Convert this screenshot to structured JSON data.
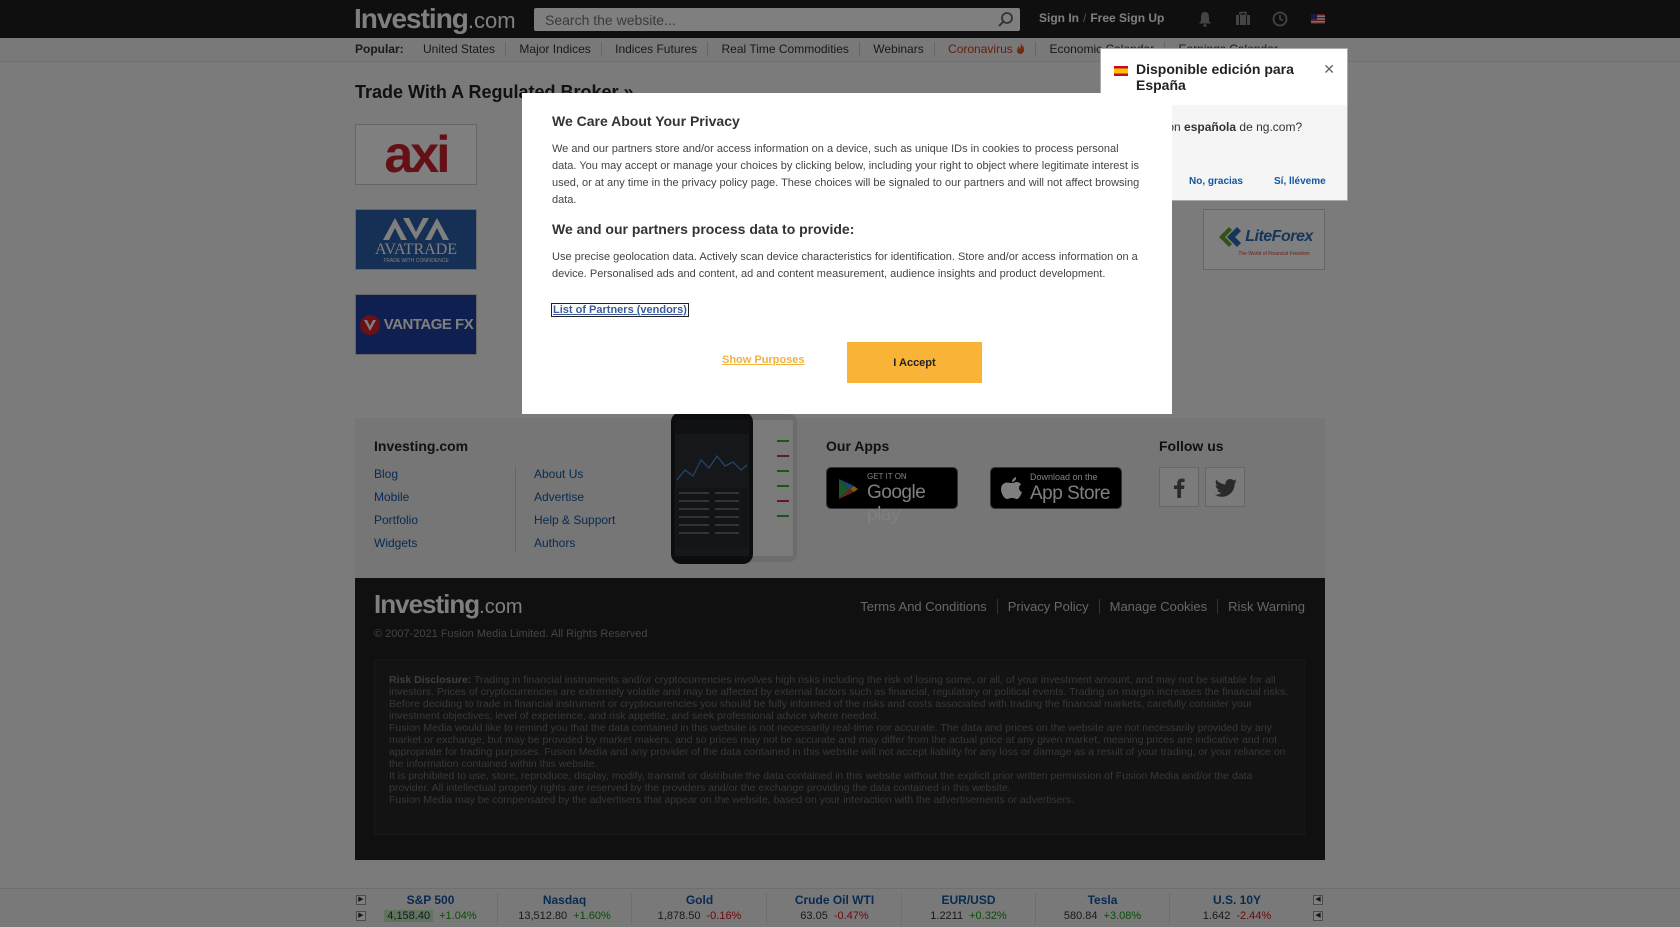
{
  "header": {
    "logo_main": "Investing",
    "logo_suffix": ".com",
    "search_placeholder": "Search the website...",
    "sign_in": "Sign In",
    "sign_sep": "/",
    "free_sign_up": "Free Sign Up"
  },
  "popular": {
    "label": "Popular:",
    "items": [
      "United States",
      "Major Indices",
      "Indices Futures",
      "Real Time Commodities",
      "Webinars",
      "Coronavirus",
      "Economic Calendar",
      "Earnings Calendar"
    ]
  },
  "trade": {
    "title": "Trade With A Regulated Broker »",
    "brokers": [
      "axi",
      "AVATRADE",
      "TRADE WITH CONFIDENCE",
      "VANTAGE FX",
      "LiteForex",
      "The World of Financial Freedom"
    ]
  },
  "footer": {
    "site_heading": "Investing.com",
    "col1": [
      "Blog",
      "Mobile",
      "Portfolio",
      "Widgets"
    ],
    "col2": [
      "About Us",
      "Advertise",
      "Help & Support",
      "Authors"
    ],
    "apps_heading": "Our Apps",
    "google_small": "GET IT ON",
    "google_big": "Google play",
    "apple_small": "Download on the",
    "apple_big": "App Store",
    "follow_heading": "Follow us",
    "dark_logo_main": "Investing",
    "dark_logo_suffix": ".com",
    "links": [
      "Terms And Conditions",
      "Privacy Policy",
      "Manage Cookies",
      "Risk Warning"
    ],
    "copyright": "© 2007-2021 Fusion Media Limited. All Rights Reserved",
    "risk_label": "Risk Disclosure:",
    "risk_p1": "Trading in financial instruments and/or cryptocurrencies involves high risks including the risk of losing some, or all, of your investment amount, and may not be suitable for all investors. Prices of cryptocurrencies are extremely volatile and may be affected by external factors such as financial, regulatory or political events. Trading on margin increases the financial risks.",
    "risk_p2": "Before deciding to trade in financial instrument or cryptocurrencies you should be fully informed of the risks and costs associated with trading the financial markets, carefully consider your investment objectives, level of experience, and risk appetite, and seek professional advice where needed.",
    "risk_p3": "Fusion Media would like to remind you that the data contained in this website is not necessarily real-time nor accurate. The data and prices on the website are not necessarily provided by any market or exchange, but may be provided by market makers, and so prices may not be accurate and may differ from the actual price at any given market, meaning prices are indicative and not appropriate for trading purposes. Fusion Media and any provider of the data contained in this website will not accept liability for any loss or damage as a result of your trading, or your reliance on the information contained within this website.",
    "risk_p4": "It is prohibited to use, store, reproduce, display, modify, transmit or distribute the data contained in this website without the explicit prior written permission of Fusion Media and/or the data provider. All intellectual property rights are reserved by the providers and/or the exchange providing the data contained in this website.",
    "risk_p5": "Fusion Media may be compensated by the advertisers that appear on the website, based on your interaction with the advertisements or advertisers."
  },
  "ticker": [
    {
      "name": "S&P 500",
      "price": "4,158.40",
      "change": "+1.04%",
      "dir": "up"
    },
    {
      "name": "Nasdaq",
      "price": "13,512.80",
      "change": "+1.60%",
      "dir": "up"
    },
    {
      "name": "Gold",
      "price": "1,878.50",
      "change": "-0.16%",
      "dir": "down"
    },
    {
      "name": "Crude Oil WTI",
      "price": "63.05",
      "change": "-0.47%",
      "dir": "down"
    },
    {
      "name": "EUR/USD",
      "price": "1.2211",
      "change": "+0.32%",
      "dir": "up"
    },
    {
      "name": "Tesla",
      "price": "580.84",
      "change": "+3.08%",
      "dir": "up"
    },
    {
      "name": "U.S. 10Y",
      "price": "1.642",
      "change": "-2.44%",
      "dir": "down"
    }
  ],
  "spain_popup": {
    "title": "Disponible edición para España",
    "text_pre": "re la edición ",
    "text_bold": "española",
    "text_post": " de ng.com?",
    "no": "No, gracias",
    "yes": "Sí, lléveme"
  },
  "privacy_modal": {
    "title": "We Care About Your Privacy",
    "p1": "We and our partners store and/or access information on a device, such as unique IDs in cookies to process personal data. You may accept or manage your choices by clicking below, including your right to object where legitimate interest is used, or at any time in the privacy policy page. These choices will be signaled to our partners and will not affect browsing data.",
    "h2": "We and our partners process data to provide:",
    "p2": "Use precise geolocation data. Actively scan device characteristics for identification. Store and/or access information on a device. Personalised ads and content, ad and content measurement, audience insights and product development.",
    "partners_link": "List of Partners (vendors)",
    "show_purposes": "Show Purposes",
    "accept": "I Accept"
  },
  "colors": {
    "header_bg": "#1f1f1f",
    "accept_btn": "#f9b337",
    "link_blue": "#1256a0",
    "up_green": "#0e9c0e",
    "down_red": "#d4141c"
  }
}
